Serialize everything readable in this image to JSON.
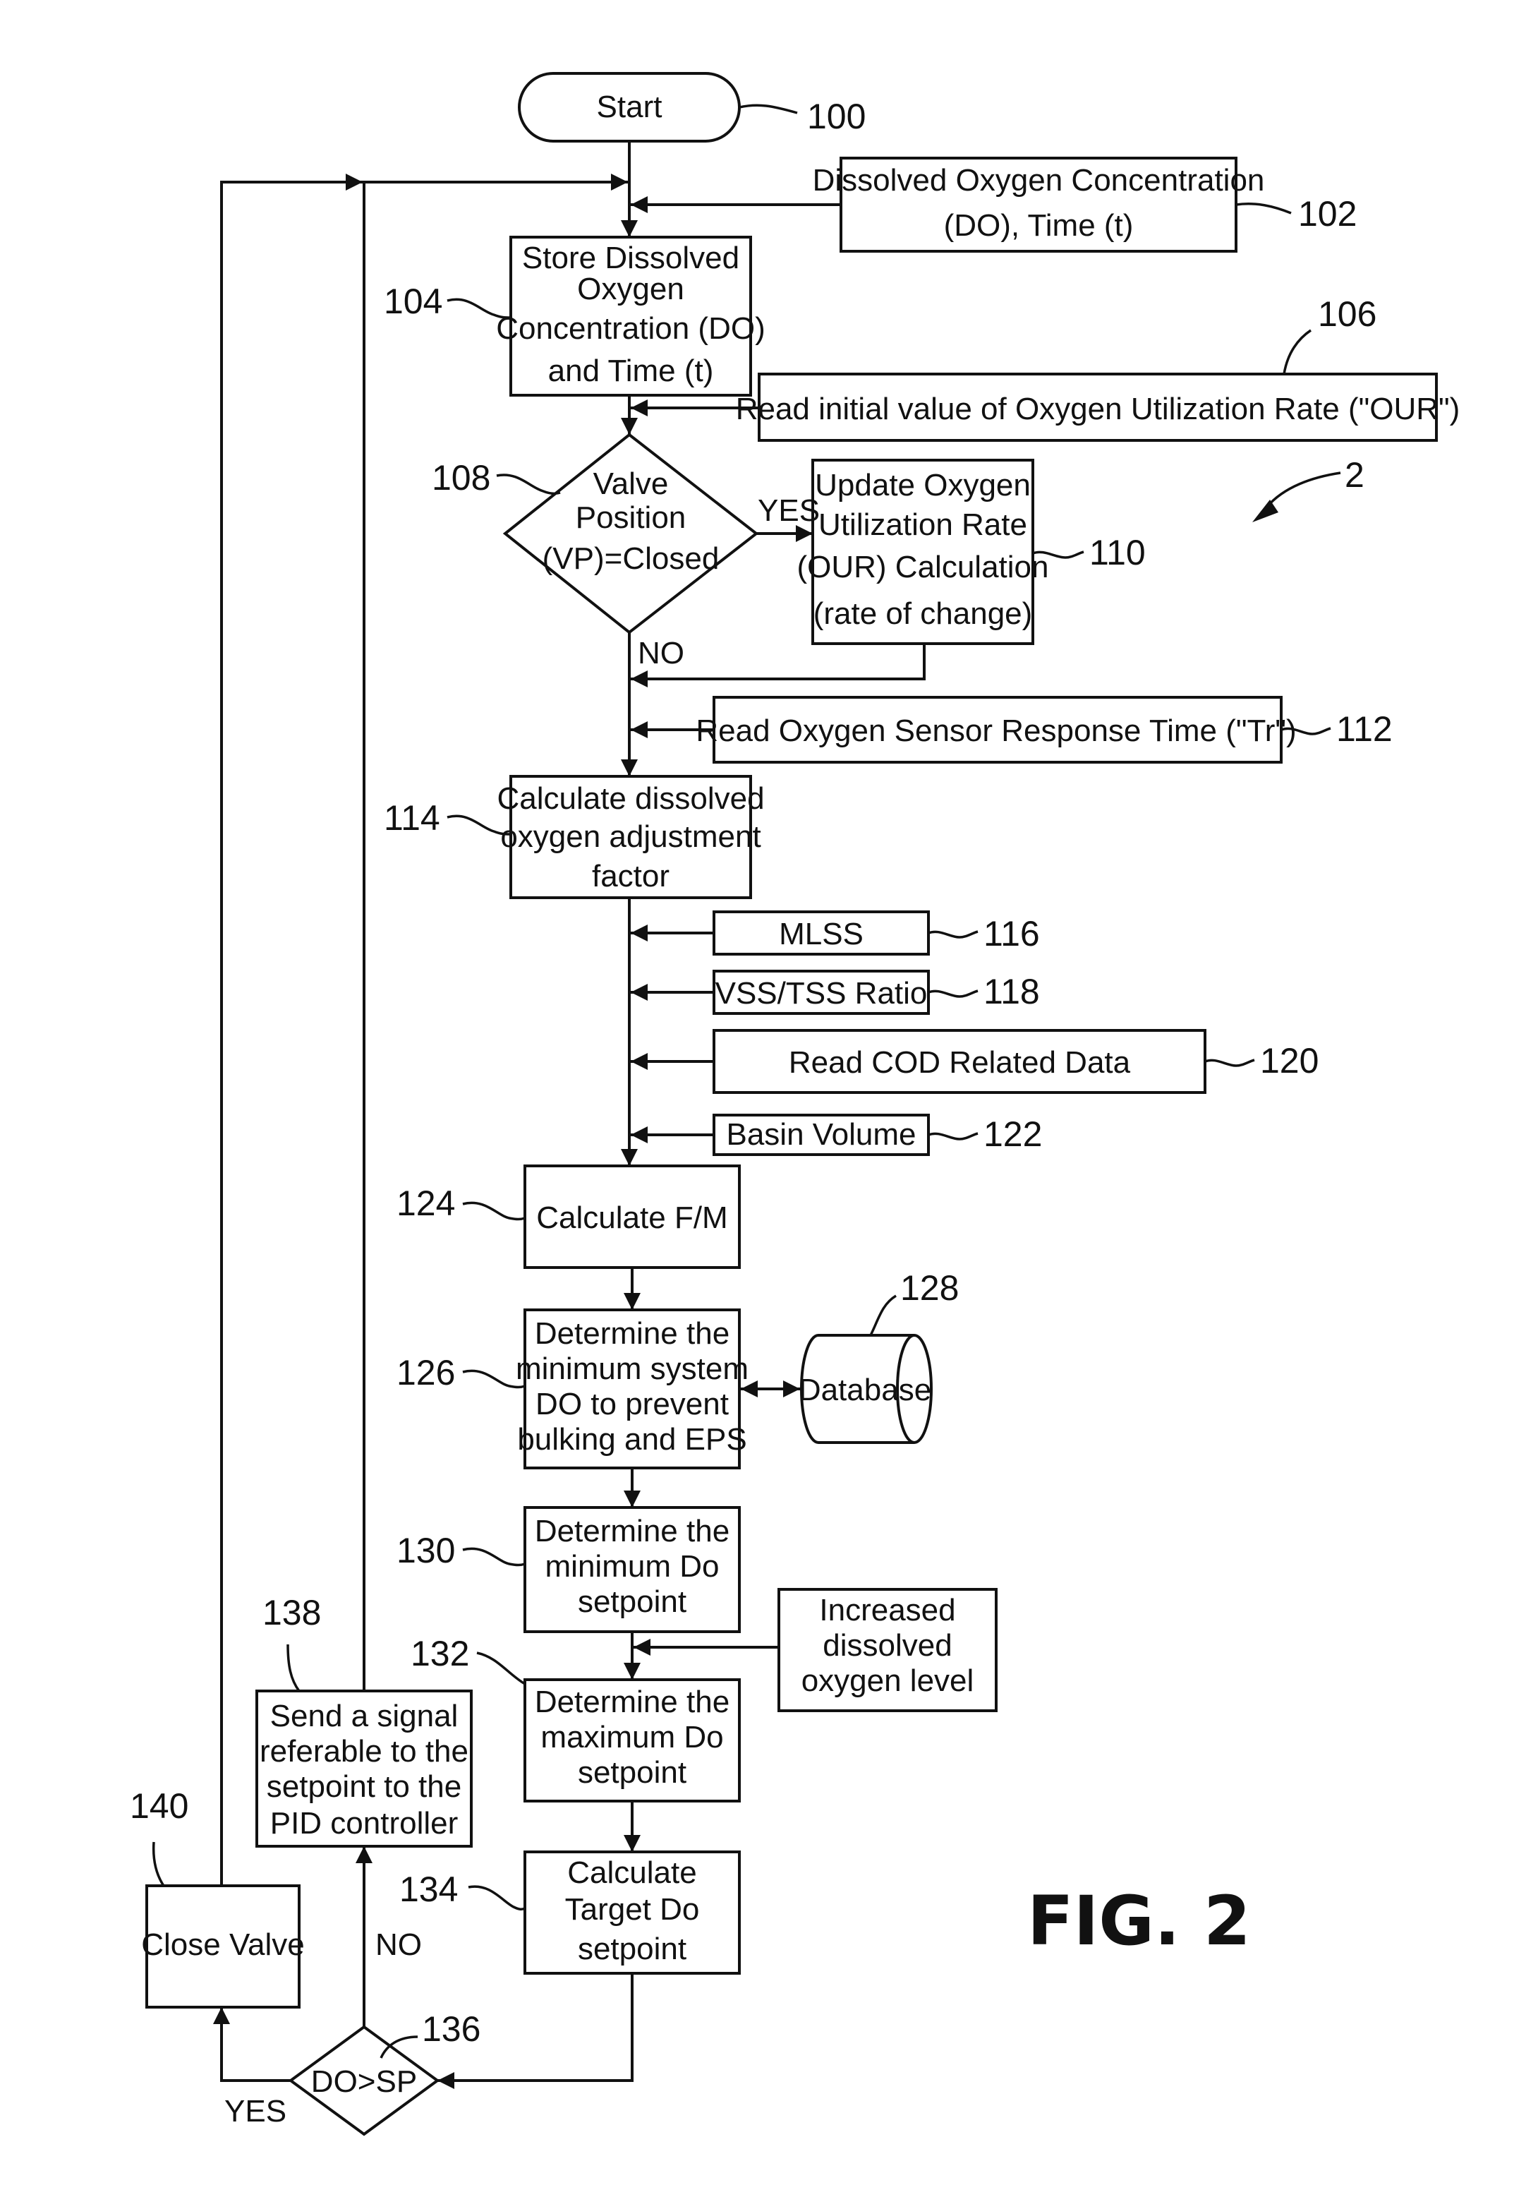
{
  "figure": {
    "title": "FIG. 2",
    "ref": "2"
  },
  "nodes": {
    "start": {
      "ref": "100",
      "lines": [
        "Start"
      ]
    },
    "input_do_time": {
      "ref": "102",
      "lines": [
        "Dissolved Oxygen Concentration",
        "(DO), Time (t)"
      ]
    },
    "store_do": {
      "ref": "104",
      "lines": [
        "Store Dissolved",
        "Oxygen",
        "Concentration (DO)",
        "and Time (t)"
      ]
    },
    "read_our": {
      "ref": "106",
      "lines": [
        "Read initial value of Oxygen Utilization Rate (\"OUR\")"
      ]
    },
    "valve_decision": {
      "ref": "108",
      "lines": [
        "Valve",
        "Position",
        "(VP)=Closed"
      ],
      "yes_label": "YES",
      "no_label": "NO"
    },
    "update_our": {
      "ref": "110",
      "lines": [
        "Update Oxygen",
        "Utilization Rate",
        "(OUR) Calculation",
        "(rate of change)"
      ]
    },
    "read_tr": {
      "ref": "112",
      "lines": [
        "Read Oxygen Sensor Response Time (\"Tr\")"
      ]
    },
    "calc_adjust": {
      "ref": "114",
      "lines": [
        "Calculate dissolved",
        "oxygen adjustment",
        "factor"
      ]
    },
    "mlss": {
      "ref": "116",
      "lines": [
        "MLSS"
      ]
    },
    "vss_tss": {
      "ref": "118",
      "lines": [
        "VSS/TSS Ratio"
      ]
    },
    "cod": {
      "ref": "120",
      "lines": [
        "Read COD Related Data"
      ]
    },
    "basin": {
      "ref": "122",
      "lines": [
        "Basin Volume"
      ]
    },
    "calc_fm": {
      "ref": "124",
      "lines": [
        "Calculate F/M"
      ]
    },
    "min_system_do": {
      "ref": "126",
      "lines": [
        "Determine the",
        "minimum system",
        "DO to prevent",
        "bulking and EPS"
      ]
    },
    "database": {
      "ref": "128",
      "lines": [
        "Database"
      ]
    },
    "min_setpoint": {
      "ref": "130",
      "lines": [
        "Determine the",
        "minimum Do",
        "setpoint"
      ]
    },
    "increased_do": {
      "lines": [
        "Increased",
        "dissolved",
        "oxygen level"
      ]
    },
    "max_setpoint": {
      "ref": "132",
      "lines": [
        "Determine the",
        "maximum Do",
        "setpoint"
      ]
    },
    "target_setpoint": {
      "ref": "134",
      "lines": [
        "Calculate",
        "Target Do",
        "setpoint"
      ]
    },
    "do_sp_decision": {
      "ref": "136",
      "lines": [
        "DO>SP"
      ],
      "yes_label": "YES",
      "no_label": "NO"
    },
    "send_signal": {
      "ref": "138",
      "lines": [
        "Send a signal",
        "referable to the",
        "setpoint to the",
        "PID controller"
      ]
    },
    "close_valve": {
      "ref": "140",
      "lines": [
        "Close Valve"
      ]
    }
  }
}
